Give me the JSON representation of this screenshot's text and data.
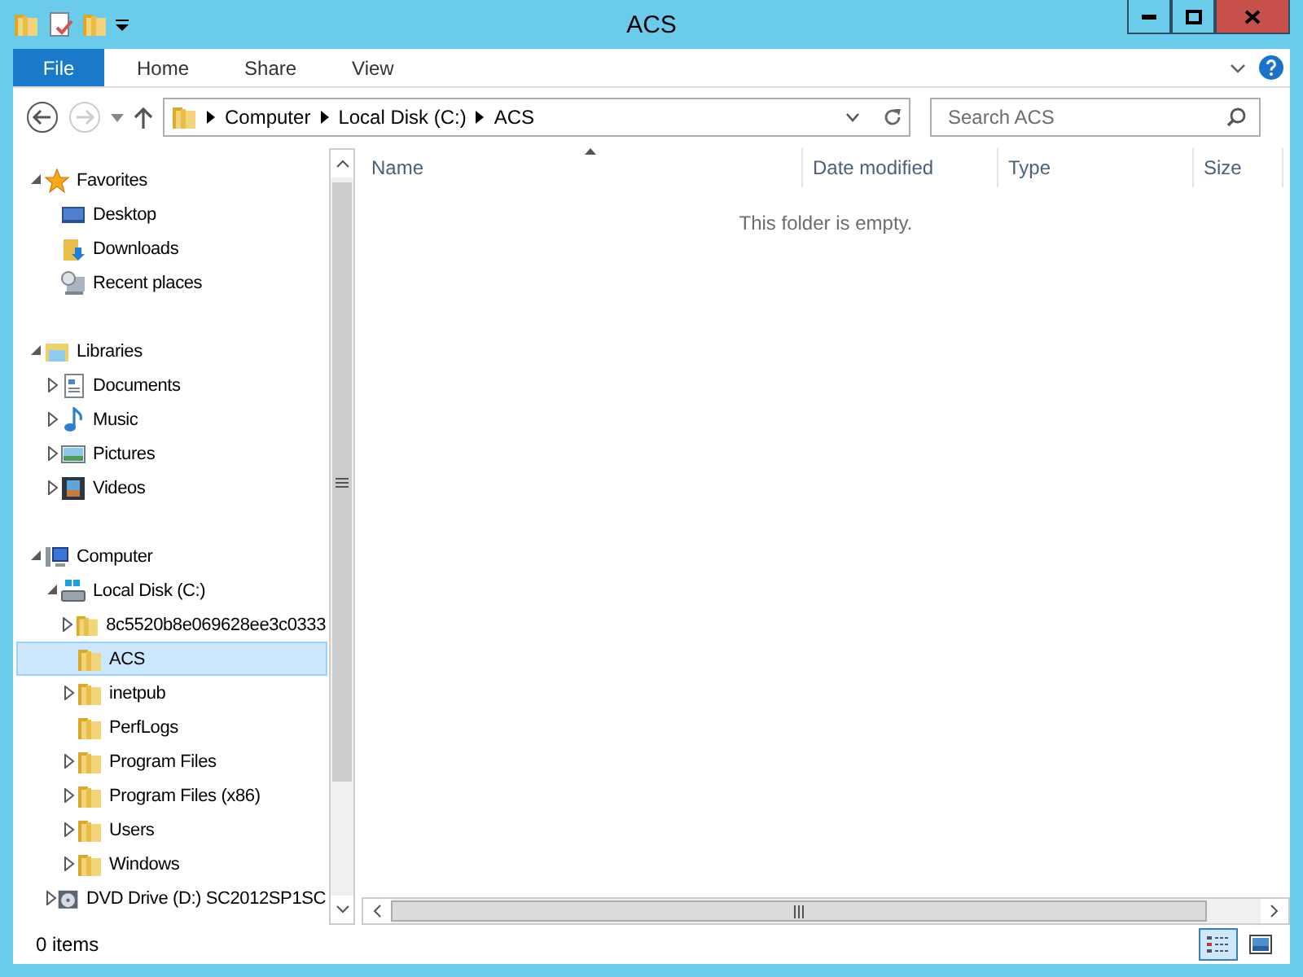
{
  "window": {
    "title": "ACS"
  },
  "ribbon": {
    "tabs": [
      {
        "label": "File",
        "kind": "file"
      },
      {
        "label": "Home",
        "kind": "tab"
      },
      {
        "label": "Share",
        "kind": "tab"
      },
      {
        "label": "View",
        "kind": "tab"
      }
    ]
  },
  "address": {
    "crumbs": [
      "Computer",
      "Local Disk (C:)",
      "ACS"
    ],
    "search_placeholder": "Search ACS"
  },
  "tree": [
    {
      "label": "Favorites",
      "kind": "star",
      "expanded": true,
      "selected": false,
      "children": [
        {
          "label": "Desktop",
          "kind": "desktop",
          "selected": false
        },
        {
          "label": "Downloads",
          "kind": "downloads",
          "selected": false
        },
        {
          "label": "Recent places",
          "kind": "recent",
          "selected": false
        }
      ]
    },
    {
      "label": "Libraries",
      "kind": "library",
      "expanded": true,
      "selected": false,
      "children": [
        {
          "label": "Documents",
          "kind": "documents",
          "expanded": false,
          "selected": false
        },
        {
          "label": "Music",
          "kind": "music",
          "expanded": false,
          "selected": false
        },
        {
          "label": "Pictures",
          "kind": "pictures",
          "expanded": false,
          "selected": false
        },
        {
          "label": "Videos",
          "kind": "videos",
          "expanded": false,
          "selected": false
        }
      ]
    },
    {
      "label": "Computer",
      "kind": "computer",
      "expanded": true,
      "selected": false,
      "children": [
        {
          "label": "Local Disk (C:)",
          "kind": "drive",
          "expanded": true,
          "selected": false,
          "children": [
            {
              "label": "8c5520b8e069628ee3c0333",
              "kind": "folder",
              "expanded": false,
              "selected": false
            },
            {
              "label": "ACS",
              "kind": "folder",
              "selected": true
            },
            {
              "label": "inetpub",
              "kind": "folder",
              "expanded": false,
              "selected": false
            },
            {
              "label": "PerfLogs",
              "kind": "folder",
              "selected": false
            },
            {
              "label": "Program Files",
              "kind": "folder",
              "expanded": false,
              "selected": false
            },
            {
              "label": "Program Files (x86)",
              "kind": "folder",
              "expanded": false,
              "selected": false
            },
            {
              "label": "Users",
              "kind": "folder",
              "expanded": false,
              "selected": false
            },
            {
              "label": "Windows",
              "kind": "folder",
              "expanded": false,
              "selected": false
            }
          ]
        },
        {
          "label": "DVD Drive (D:) SC2012SP1SC",
          "kind": "dvd",
          "expanded": false,
          "selected": false
        }
      ]
    }
  ],
  "columns": [
    "Name",
    "Date modified",
    "Type",
    "Size"
  ],
  "empty_message": "This folder is empty.",
  "status_bar": {
    "text": "0 items",
    "views": [
      {
        "kind": "details",
        "selected": true
      },
      {
        "kind": "thumbnails",
        "selected": false
      }
    ]
  }
}
